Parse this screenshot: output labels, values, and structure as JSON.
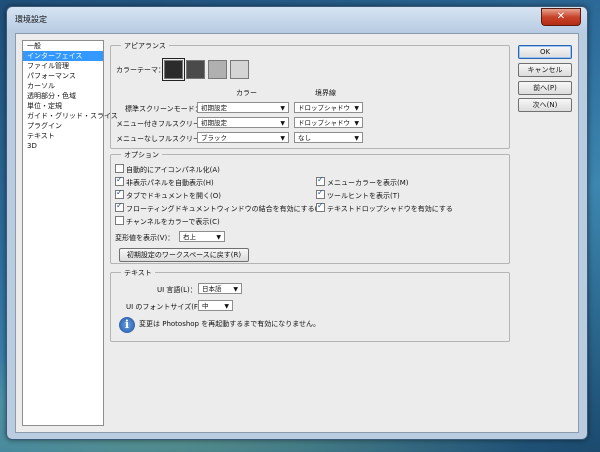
{
  "window": {
    "title": "環境設定",
    "close_glyph": "✕"
  },
  "sidebar": {
    "items": [
      {
        "label": "一般"
      },
      {
        "label": "インターフェイス"
      },
      {
        "label": "ファイル管理"
      },
      {
        "label": "パフォーマンス"
      },
      {
        "label": "カーソル"
      },
      {
        "label": "透明部分・色域"
      },
      {
        "label": "単位・定規"
      },
      {
        "label": "ガイド・グリッド・スライス"
      },
      {
        "label": "プラグイン"
      },
      {
        "label": "テキスト"
      },
      {
        "label": "3D"
      }
    ],
    "selected_index": 1
  },
  "appearance": {
    "legend": "アピアランス",
    "color_theme_label": "カラーテーマ：",
    "swatches": [
      "#2b2b2b",
      "#4a4a4a",
      "#b0b0b0",
      "#d4d4d4"
    ],
    "col_color": "カラー",
    "col_border": "境界線",
    "rows": [
      {
        "label": "標準スクリーンモード：",
        "color": "初期設定",
        "border": "ドロップシャドウ"
      },
      {
        "label": "メニュー付きフルスクリーン：",
        "color": "初期設定",
        "border": "ドロップシャドウ"
      },
      {
        "label": "メニューなしフルスクリーン：",
        "color": "ブラック",
        "border": "なし"
      }
    ]
  },
  "options": {
    "legend": "オプション",
    "left": [
      {
        "label": "自動的にアイコンパネル化(A)",
        "checked": false
      },
      {
        "label": "非表示パネルを自動表示(H)",
        "checked": true
      },
      {
        "label": "タブでドキュメントを開く(O)",
        "checked": true
      },
      {
        "label": "フローティングドキュメントウィンドウの結合を有効にする(D)",
        "checked": true
      },
      {
        "label": "チャンネルをカラーで表示(C)",
        "checked": false
      }
    ],
    "right": [
      {
        "label": "メニューカラーを表示(M)",
        "checked": true
      },
      {
        "label": "ツールヒントを表示(T)",
        "checked": true
      },
      {
        "label": "テキストドロップシャドウを有効にする",
        "checked": true
      }
    ],
    "transform_label": "変形値を表示(V)：",
    "transform_value": "右上",
    "reset_button": "初期設定のワークスペースに戻す(R)"
  },
  "text": {
    "legend": "テキスト",
    "ui_lang_label": "UI 言語(L)：",
    "ui_lang_value": "日本語",
    "ui_font_label": "UI のフォントサイズ(F)：",
    "ui_font_value": "中",
    "info_glyph": "i",
    "notice": "変更は Photoshop を再起動するまで有効になりません。"
  },
  "buttons": {
    "ok": "OK",
    "cancel": "キャンセル",
    "prev": "前へ(P)",
    "next": "次へ(N)"
  },
  "dropdown_arrow": "▼"
}
